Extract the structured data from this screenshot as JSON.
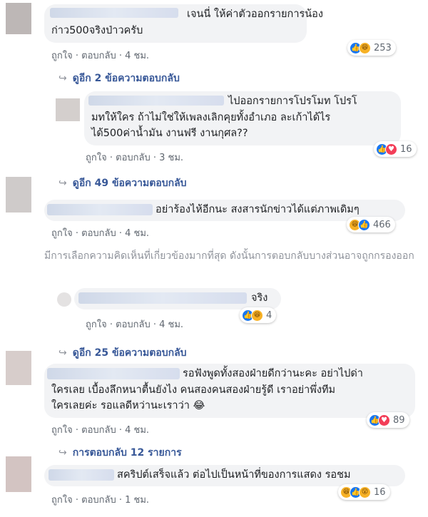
{
  "comments": [
    {
      "lines": [
        "เจนนี่ ให้ค่าตัวออกรายการน้อง",
        "ก่าว500จริงป่าวครับ"
      ],
      "meta": {
        "like": "ถูกใจ",
        "reply": "ตอบกลับ",
        "time": "4 ชม."
      },
      "reactions": {
        "icons": [
          "like-icon",
          "haha-icon"
        ],
        "count": "253"
      }
    },
    {
      "lines": [
        "ไปออกรายการโปรโมท โปรโ",
        "มทให้ใคร ถ้าไม่ใช่ให้เพลงเลิกคุยทั้งอำเภอ ละเก้าได้ไร",
        "ได้500ค่าน้ำมัน งานฟรี งานกุศล??"
      ],
      "meta": {
        "like": "ถูกใจ",
        "reply": "ตอบกลับ",
        "time": "3 ชม."
      },
      "reactions": {
        "icons": [
          "like-icon",
          "love-icon"
        ],
        "count": "16"
      }
    },
    {
      "lines": [
        "อย่าร้องไห้อีกนะ สงสารนักข่าวได้แต่ภาพเดิมๆ"
      ],
      "meta": {
        "like": "ถูกใจ",
        "reply": "ตอบกลับ",
        "time": "4 ชม."
      },
      "reactions": {
        "icons": [
          "haha-icon",
          "like-icon"
        ],
        "count": "466"
      }
    },
    {
      "lines": [
        "จริง"
      ],
      "meta": {
        "like": "ถูกใจ",
        "reply": "ตอบกลับ",
        "time": "4 ชม."
      },
      "reactions": {
        "icons": [
          "like-icon",
          "haha-icon"
        ],
        "count": "4"
      }
    },
    {
      "lines": [
        "รอฟังพูดทั้งสองฝ่ายดีกว่านะคะ อย่าไปด่า",
        "ใครเลย เบื้องลึกหนาตื้นยังไง คนสองคนสองฝ่ายรู้ดี เราอย่าพึ่งทีม",
        "ใครเลยค่ะ รอแลดีหว่านะเราว่า 😂"
      ],
      "meta": {
        "like": "ถูกใจ",
        "reply": "ตอบกลับ",
        "time": "4 ชม."
      },
      "reactions": {
        "icons": [
          "like-icon",
          "love-icon"
        ],
        "count": "89"
      }
    },
    {
      "lines": [
        "สคริปต์เสร็จแล้ว ต่อไปเป็นหน้าที่ของการแสดง รอชม"
      ],
      "meta": {
        "like": "ถูกใจ",
        "reply": "ตอบกลับ",
        "time": "1 ชม."
      },
      "reactions": {
        "icons": [
          "haha-icon",
          "like-icon",
          "wow-icon"
        ],
        "count": "16"
      }
    }
  ],
  "reply_links": {
    "first": "ดูอีก 2 ข้อความตอบกลับ",
    "second": "ดูอีก 49 ข้อความตอบกลับ",
    "third": "ดูอีก 25 ข้อความตอบกลับ",
    "fourth": "การตอบกลับ 12 รายการ"
  },
  "notice": "มีการเลือกความคิดเห็นที่เกี่ยวข้องมากที่สุด ดังนั้นการตอบกลับบางส่วนอาจถูกกรองออก",
  "colors": {
    "link": "#385898",
    "meta": "#606770",
    "bubble": "#f2f3f5",
    "like": "#1877f2"
  }
}
